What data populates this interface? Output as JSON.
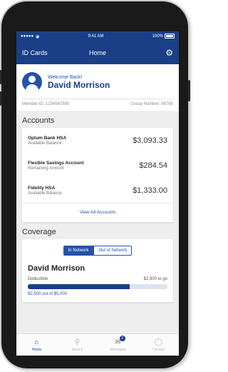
{
  "status_bar": {
    "carrier": "●●●●● ",
    "time": "9:41 AM",
    "battery": "100%"
  },
  "navbar": {
    "left_label": "ID Cards",
    "title": "Home"
  },
  "welcome": {
    "greeting": "Welcome Back!",
    "name": "David Morrison",
    "member_id": "Member ID: 1234567890",
    "group_number": "Group Number: 98765"
  },
  "accounts": {
    "section_title": "Accounts",
    "items": [
      {
        "name": "Optum Bank HSA",
        "sub": "Available Balance",
        "amount": "$3,093.33"
      },
      {
        "name": "Flexible Savings Account",
        "sub": "Remaining Amount",
        "amount": "$284.54"
      },
      {
        "name": "Fidelity HSA",
        "sub": "Available Balance",
        "amount": "$1,333.00"
      }
    ],
    "view_all": "View All Accounts"
  },
  "coverage": {
    "section_title": "Coverage",
    "toggle": {
      "on": "In Network",
      "off": "Out of Network"
    },
    "name": "David Morrison",
    "deductible_label": "Deductible",
    "deductible_remaining": "$2,500 to go",
    "deductible_progress": 0.73,
    "footnote": "$2,500 out of $5,000"
  },
  "tabbar": {
    "items": [
      {
        "label": "Home",
        "icon": "home-icon"
      },
      {
        "label": "Search",
        "icon": "search-icon"
      },
      {
        "label": "Messages",
        "icon": "mail-icon",
        "badge": "2"
      },
      {
        "label": "Contact",
        "icon": "chat-icon"
      }
    ]
  },
  "colors": {
    "brand": "#1a3f86",
    "accent": "#2453a8"
  }
}
